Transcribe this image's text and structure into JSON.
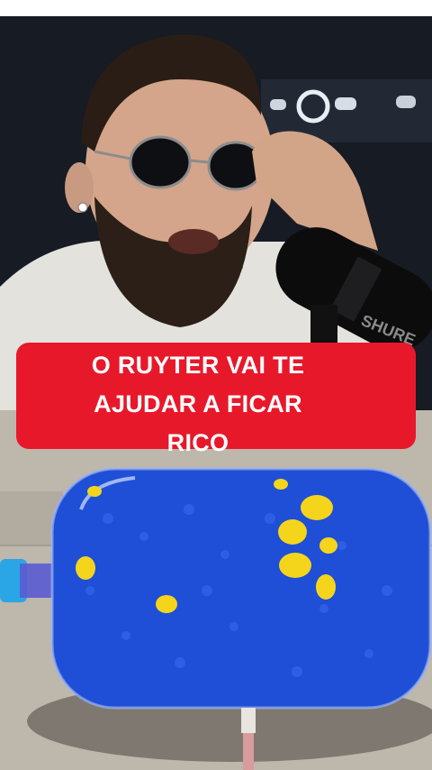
{
  "caption": {
    "line1": "O RUYTER VAI TE",
    "line2": "AJUDAR A FICAR",
    "line3": "RICO"
  },
  "scene": {
    "microphone_brand": "SHURE"
  },
  "colors": {
    "caption_background": "#e8182b",
    "caption_text": "#ffffff",
    "bottle_blue": "#1f4fd6",
    "duck_yellow": "#f4d51c"
  }
}
